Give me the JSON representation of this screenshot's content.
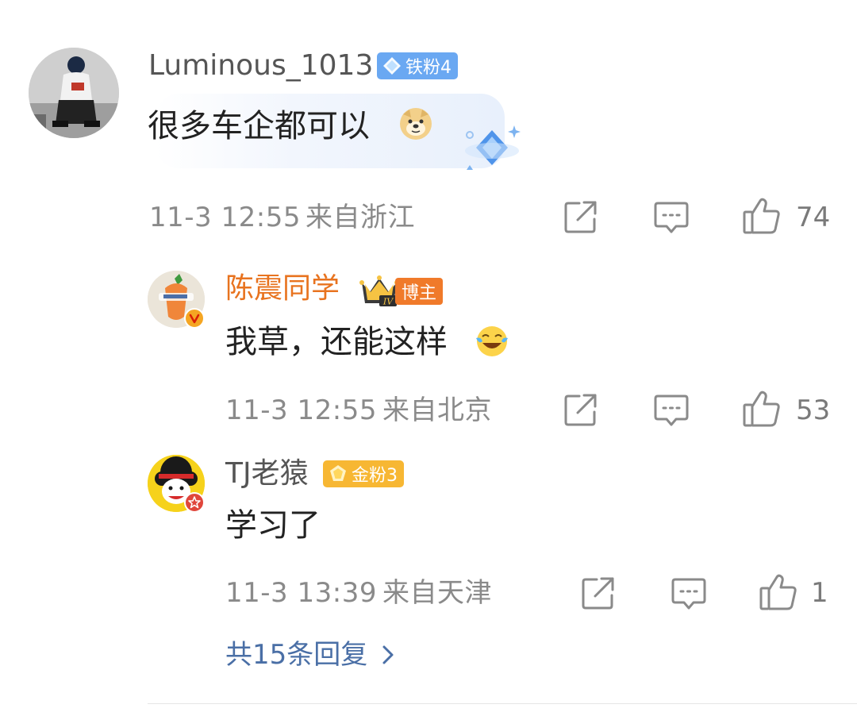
{
  "comment": {
    "username": "Luminous_1013",
    "badge": "铁粉4",
    "text": "很多车企都可以",
    "emoji": "doge-emoji",
    "time": "11-3 12:55",
    "location": "来自浙江",
    "likes": "74"
  },
  "replies": [
    {
      "username": "陈震同学",
      "badge": "博主",
      "text": "我草，还能这样",
      "emoji": "laugh-cry-emoji",
      "time": "11-3 12:55",
      "location": "来自北京",
      "likes": "53"
    },
    {
      "username": "TJ老猿",
      "badge": "金粉3",
      "text": "学习了",
      "time": "11-3 13:39",
      "location": "来自天津",
      "likes": "1"
    }
  ],
  "more_replies": "共15条回复",
  "colors": {
    "author_name": "#e8731f",
    "link": "#4a6fa6",
    "meta": "#8a8a8a",
    "iron_fan_badge": "#6aa8f2",
    "gold_fan_badge": "#f7b733",
    "blogger_badge": "#f07a2a"
  }
}
